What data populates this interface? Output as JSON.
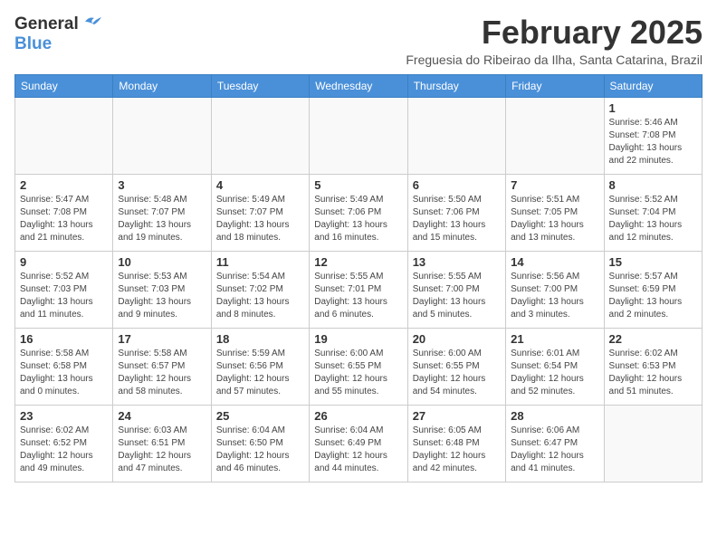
{
  "header": {
    "logo_general": "General",
    "logo_blue": "Blue",
    "month_title": "February 2025",
    "subtitle": "Freguesia do Ribeirao da Ilha, Santa Catarina, Brazil"
  },
  "weekdays": [
    "Sunday",
    "Monday",
    "Tuesday",
    "Wednesday",
    "Thursday",
    "Friday",
    "Saturday"
  ],
  "weeks": [
    [
      {
        "day": "",
        "info": ""
      },
      {
        "day": "",
        "info": ""
      },
      {
        "day": "",
        "info": ""
      },
      {
        "day": "",
        "info": ""
      },
      {
        "day": "",
        "info": ""
      },
      {
        "day": "",
        "info": ""
      },
      {
        "day": "1",
        "info": "Sunrise: 5:46 AM\nSunset: 7:08 PM\nDaylight: 13 hours\nand 22 minutes."
      }
    ],
    [
      {
        "day": "2",
        "info": "Sunrise: 5:47 AM\nSunset: 7:08 PM\nDaylight: 13 hours\nand 21 minutes."
      },
      {
        "day": "3",
        "info": "Sunrise: 5:48 AM\nSunset: 7:07 PM\nDaylight: 13 hours\nand 19 minutes."
      },
      {
        "day": "4",
        "info": "Sunrise: 5:49 AM\nSunset: 7:07 PM\nDaylight: 13 hours\nand 18 minutes."
      },
      {
        "day": "5",
        "info": "Sunrise: 5:49 AM\nSunset: 7:06 PM\nDaylight: 13 hours\nand 16 minutes."
      },
      {
        "day": "6",
        "info": "Sunrise: 5:50 AM\nSunset: 7:06 PM\nDaylight: 13 hours\nand 15 minutes."
      },
      {
        "day": "7",
        "info": "Sunrise: 5:51 AM\nSunset: 7:05 PM\nDaylight: 13 hours\nand 13 minutes."
      },
      {
        "day": "8",
        "info": "Sunrise: 5:52 AM\nSunset: 7:04 PM\nDaylight: 13 hours\nand 12 minutes."
      }
    ],
    [
      {
        "day": "9",
        "info": "Sunrise: 5:52 AM\nSunset: 7:03 PM\nDaylight: 13 hours\nand 11 minutes."
      },
      {
        "day": "10",
        "info": "Sunrise: 5:53 AM\nSunset: 7:03 PM\nDaylight: 13 hours\nand 9 minutes."
      },
      {
        "day": "11",
        "info": "Sunrise: 5:54 AM\nSunset: 7:02 PM\nDaylight: 13 hours\nand 8 minutes."
      },
      {
        "day": "12",
        "info": "Sunrise: 5:55 AM\nSunset: 7:01 PM\nDaylight: 13 hours\nand 6 minutes."
      },
      {
        "day": "13",
        "info": "Sunrise: 5:55 AM\nSunset: 7:00 PM\nDaylight: 13 hours\nand 5 minutes."
      },
      {
        "day": "14",
        "info": "Sunrise: 5:56 AM\nSunset: 7:00 PM\nDaylight: 13 hours\nand 3 minutes."
      },
      {
        "day": "15",
        "info": "Sunrise: 5:57 AM\nSunset: 6:59 PM\nDaylight: 13 hours\nand 2 minutes."
      }
    ],
    [
      {
        "day": "16",
        "info": "Sunrise: 5:58 AM\nSunset: 6:58 PM\nDaylight: 13 hours\nand 0 minutes."
      },
      {
        "day": "17",
        "info": "Sunrise: 5:58 AM\nSunset: 6:57 PM\nDaylight: 12 hours\nand 58 minutes."
      },
      {
        "day": "18",
        "info": "Sunrise: 5:59 AM\nSunset: 6:56 PM\nDaylight: 12 hours\nand 57 minutes."
      },
      {
        "day": "19",
        "info": "Sunrise: 6:00 AM\nSunset: 6:55 PM\nDaylight: 12 hours\nand 55 minutes."
      },
      {
        "day": "20",
        "info": "Sunrise: 6:00 AM\nSunset: 6:55 PM\nDaylight: 12 hours\nand 54 minutes."
      },
      {
        "day": "21",
        "info": "Sunrise: 6:01 AM\nSunset: 6:54 PM\nDaylight: 12 hours\nand 52 minutes."
      },
      {
        "day": "22",
        "info": "Sunrise: 6:02 AM\nSunset: 6:53 PM\nDaylight: 12 hours\nand 51 minutes."
      }
    ],
    [
      {
        "day": "23",
        "info": "Sunrise: 6:02 AM\nSunset: 6:52 PM\nDaylight: 12 hours\nand 49 minutes."
      },
      {
        "day": "24",
        "info": "Sunrise: 6:03 AM\nSunset: 6:51 PM\nDaylight: 12 hours\nand 47 minutes."
      },
      {
        "day": "25",
        "info": "Sunrise: 6:04 AM\nSunset: 6:50 PM\nDaylight: 12 hours\nand 46 minutes."
      },
      {
        "day": "26",
        "info": "Sunrise: 6:04 AM\nSunset: 6:49 PM\nDaylight: 12 hours\nand 44 minutes."
      },
      {
        "day": "27",
        "info": "Sunrise: 6:05 AM\nSunset: 6:48 PM\nDaylight: 12 hours\nand 42 minutes."
      },
      {
        "day": "28",
        "info": "Sunrise: 6:06 AM\nSunset: 6:47 PM\nDaylight: 12 hours\nand 41 minutes."
      },
      {
        "day": "",
        "info": ""
      }
    ]
  ]
}
